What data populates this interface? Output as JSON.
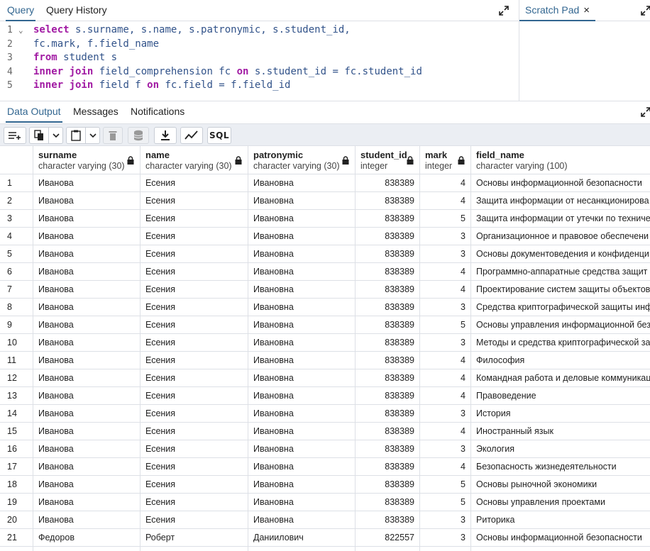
{
  "tabs": {
    "query": "Query",
    "history": "Query History",
    "scratch": "Scratch Pad",
    "close": "×"
  },
  "editor": {
    "lines": [
      {
        "n": "1",
        "tokens": [
          {
            "t": "select",
            "k": true
          },
          {
            "t": " s.surname, s.name, s.patronymic, s.student_id,",
            "k": false
          }
        ]
      },
      {
        "n": "2",
        "tokens": [
          {
            "t": "fc.mark, f.field_name",
            "k": false
          }
        ]
      },
      {
        "n": "3",
        "tokens": [
          {
            "t": "from",
            "k": true
          },
          {
            "t": " student s",
            "k": false
          }
        ]
      },
      {
        "n": "4",
        "tokens": [
          {
            "t": "inner join",
            "k": true
          },
          {
            "t": " field_comprehension fc ",
            "k": false
          },
          {
            "t": "on",
            "k": true
          },
          {
            "t": " s.student_id = fc.student_id",
            "k": false
          }
        ]
      },
      {
        "n": "5",
        "tokens": [
          {
            "t": "inner join",
            "k": true
          },
          {
            "t": " field f ",
            "k": false
          },
          {
            "t": "on",
            "k": true
          },
          {
            "t": " fc.field = f.field_id",
            "k": false
          }
        ]
      }
    ]
  },
  "output_tabs": {
    "data": "Data Output",
    "messages": "Messages",
    "notifications": "Notifications"
  },
  "toolbar": {
    "sql": "SQL",
    "icons": [
      "add-row-icon",
      "copy-icon",
      "chevron-down-icon",
      "paste-icon",
      "chevron-down-icon",
      "delete-icon",
      "save-data-icon",
      "download-icon",
      "graph-icon",
      "sql-icon"
    ]
  },
  "grid": {
    "columns": [
      {
        "name": "surname",
        "type": "character varying (30)"
      },
      {
        "name": "name",
        "type": "character varying (30)"
      },
      {
        "name": "patronymic",
        "type": "character varying (30)"
      },
      {
        "name": "student_id",
        "type": "integer"
      },
      {
        "name": "mark",
        "type": "integer"
      },
      {
        "name": "field_name",
        "type": "character varying (100)"
      }
    ],
    "rows": [
      [
        "1",
        "Иванова",
        "Есения",
        "Ивановна",
        "838389",
        "4",
        "Основы информационной безопасности"
      ],
      [
        "2",
        "Иванова",
        "Есения",
        "Ивановна",
        "838389",
        "4",
        "Защита информации от несанкционирова"
      ],
      [
        "3",
        "Иванова",
        "Есения",
        "Ивановна",
        "838389",
        "5",
        "Защита информации от утечки по техниче"
      ],
      [
        "4",
        "Иванова",
        "Есения",
        "Ивановна",
        "838389",
        "3",
        "Организационное и правовое обеспечени"
      ],
      [
        "5",
        "Иванова",
        "Есения",
        "Ивановна",
        "838389",
        "3",
        "Основы документоведения и конфиденци"
      ],
      [
        "6",
        "Иванова",
        "Есения",
        "Ивановна",
        "838389",
        "4",
        "Программно-аппаратные средства защит"
      ],
      [
        "7",
        "Иванова",
        "Есения",
        "Ивановна",
        "838389",
        "4",
        "Проектирование систем защиты объектов"
      ],
      [
        "8",
        "Иванова",
        "Есения",
        "Ивановна",
        "838389",
        "3",
        "Средства криптографической защиты инф"
      ],
      [
        "9",
        "Иванова",
        "Есения",
        "Ивановна",
        "838389",
        "5",
        "Основы управления информационной без"
      ],
      [
        "10",
        "Иванова",
        "Есения",
        "Ивановна",
        "838389",
        "3",
        "Методы и средства криптографической за"
      ],
      [
        "11",
        "Иванова",
        "Есения",
        "Ивановна",
        "838389",
        "4",
        "Философия"
      ],
      [
        "12",
        "Иванова",
        "Есения",
        "Ивановна",
        "838389",
        "4",
        "Командная работа и деловые коммуникац"
      ],
      [
        "13",
        "Иванова",
        "Есения",
        "Ивановна",
        "838389",
        "4",
        "Правоведение"
      ],
      [
        "14",
        "Иванова",
        "Есения",
        "Ивановна",
        "838389",
        "3",
        "История"
      ],
      [
        "15",
        "Иванова",
        "Есения",
        "Ивановна",
        "838389",
        "4",
        "Иностранный язык"
      ],
      [
        "16",
        "Иванова",
        "Есения",
        "Ивановна",
        "838389",
        "3",
        "Экология"
      ],
      [
        "17",
        "Иванова",
        "Есения",
        "Ивановна",
        "838389",
        "4",
        "Безопасность жизнедеятельности"
      ],
      [
        "18",
        "Иванова",
        "Есения",
        "Ивановна",
        "838389",
        "5",
        "Основы рыночной экономики"
      ],
      [
        "19",
        "Иванова",
        "Есения",
        "Ивановна",
        "838389",
        "5",
        "Основы управления проектами"
      ],
      [
        "20",
        "Иванова",
        "Есения",
        "Ивановна",
        "838389",
        "3",
        "Риторика"
      ],
      [
        "21",
        "Федоров",
        "Роберт",
        "Даниилович",
        "822557",
        "3",
        "Основы информационной безопасности"
      ],
      [
        "",
        "",
        "",
        "",
        "",
        "",
        ""
      ]
    ]
  },
  "colors": {
    "accent": "#326690",
    "keyword": "#a11aa3",
    "code": "#32538a",
    "border": "#dde0e6",
    "toolbar_bg": "#ebeef3"
  }
}
